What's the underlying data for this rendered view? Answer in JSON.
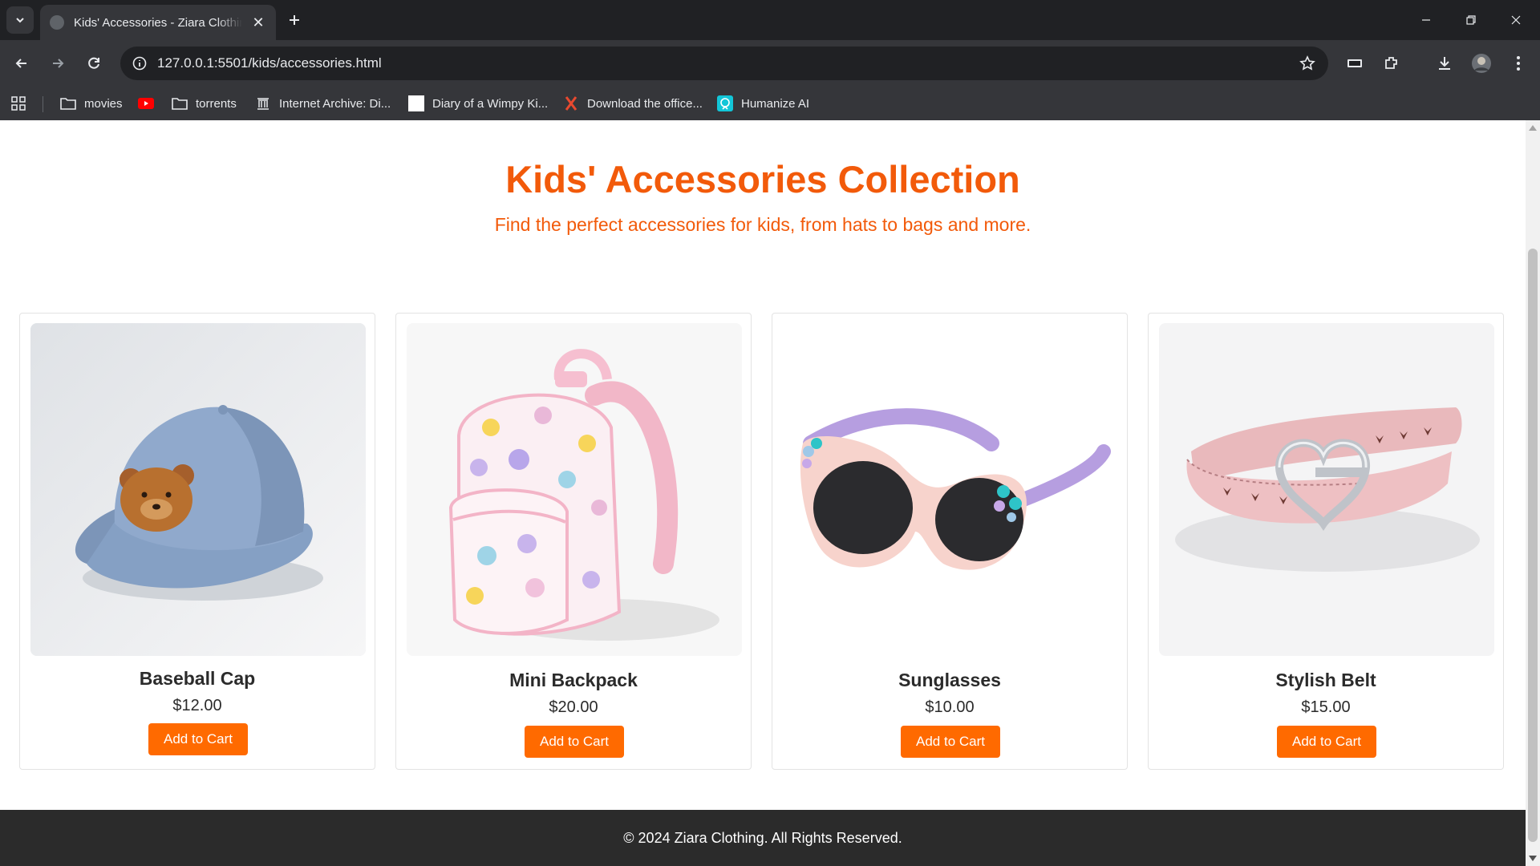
{
  "browser": {
    "tab_title": "Kids' Accessories - Ziara Clothing",
    "url": "127.0.0.1:5501/kids/accessories.html",
    "bookmarks": [
      {
        "label": "movies",
        "icon": "folder-icon"
      },
      {
        "label": "",
        "icon": "youtube-icon"
      },
      {
        "label": "torrents",
        "icon": "folder-icon"
      },
      {
        "label": "Internet Archive: Di...",
        "icon": "archive-icon"
      },
      {
        "label": "Diary of a Wimpy Ki...",
        "icon": "page-icon"
      },
      {
        "label": "Download the office...",
        "icon": "x-logo-icon"
      },
      {
        "label": "Humanize AI",
        "icon": "humanize-icon"
      }
    ]
  },
  "page": {
    "title": "Kids' Accessories Collection",
    "subtitle": "Find the perfect accessories for kids, from hats to bags and more.",
    "accent_color": "#f25a0a",
    "button_color": "#ff6a00",
    "products": [
      {
        "name": "Baseball Cap",
        "price": "$12.00",
        "button": "Add to Cart",
        "image": "blue-bear-cap"
      },
      {
        "name": "Mini Backpack",
        "price": "$20.00",
        "button": "Add to Cart",
        "image": "pink-flower-backpack"
      },
      {
        "name": "Sunglasses",
        "price": "$10.00",
        "button": "Add to Cart",
        "image": "pink-sunglasses"
      },
      {
        "name": "Stylish Belt",
        "price": "$15.00",
        "button": "Add to Cart",
        "image": "pink-heart-belt"
      }
    ],
    "footer": "© 2024 Ziara Clothing. All Rights Reserved."
  }
}
